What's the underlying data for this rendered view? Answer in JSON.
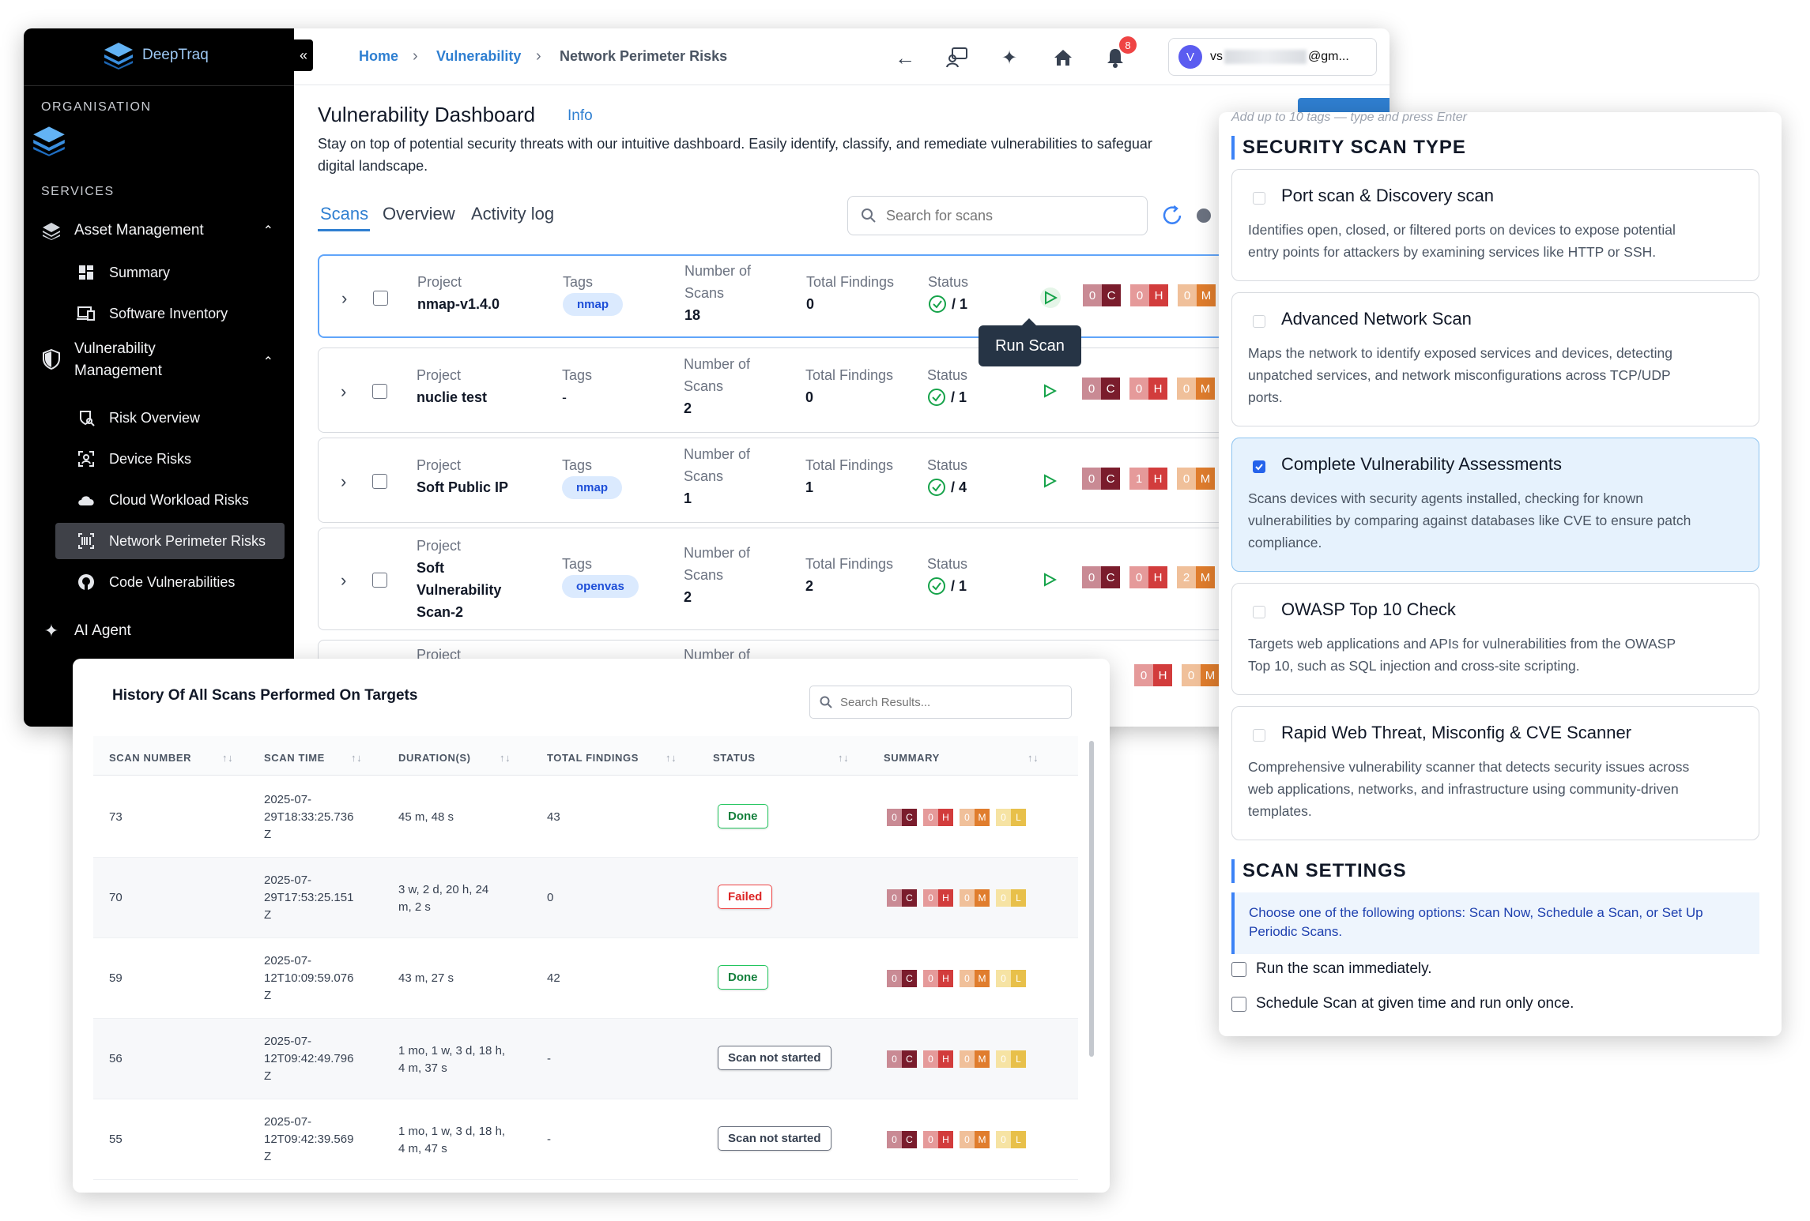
{
  "sidebar": {
    "brand": "DeepTraq",
    "org_heading": "ORGANISATION",
    "services_heading": "SERVICES",
    "asset_management": "Asset Management",
    "summary": "Summary",
    "software_inventory": "Software Inventory",
    "vulnerability_management_l1": "Vulnerability",
    "vulnerability_management_l2": "Management",
    "risk_overview": "Risk Overview",
    "device_risks": "Device Risks",
    "cloud_workload_risks": "Cloud Workload Risks",
    "network_perimeter_risks": "Network Perimeter Risks",
    "code_vulnerabilities": "Code Vulnerabilities",
    "ai_agent": "AI Agent",
    "collapse_glyph": "«"
  },
  "topbar": {
    "crumb_home": "Home",
    "crumb_vuln": "Vulnerability",
    "crumb_current": "Network Perimeter Risks",
    "notification_count": "8",
    "avatar_letter": "V",
    "user_prefix": "vs",
    "user_suffix": "@gm..."
  },
  "dashboard": {
    "title": "Vulnerability Dashboard",
    "info_link": "Info",
    "desc_l1": "Stay on top of potential security threats with our intuitive dashboard. Easily identify, classify, and remediate vulnerabilities to safeguar",
    "desc_l2": "digital landscape.",
    "tabs": {
      "scans": "Scans",
      "overview": "Overview",
      "activity": "Activity log"
    },
    "search_placeholder": "Search for scans",
    "tooltip": "Run Scan",
    "labels": {
      "project": "Project",
      "tags": "Tags",
      "scans_l1": "Number of",
      "scans_l2": "Scans",
      "findings": "Total Findings",
      "status": "Status"
    },
    "rows": [
      {
        "project": "nmap-v1.4.0",
        "tag": "nmap",
        "scans": "18",
        "findings": "0",
        "status": "/ 1",
        "c": "0",
        "h": "0",
        "m": "0"
      },
      {
        "project": "nuclie test",
        "tag": "-",
        "scans": "2",
        "findings": "0",
        "status": "/ 1",
        "c": "0",
        "h": "0",
        "m": "0"
      },
      {
        "project": "Soft Public IP",
        "tag": "nmap",
        "scans": "1",
        "findings": "1",
        "status": "/ 4",
        "c": "0",
        "h": "1",
        "m": "0"
      },
      {
        "project_l1": "Soft",
        "project_l2": "Vulnerability",
        "project_l3": "Scan-2",
        "tag": "openvas",
        "scans": "2",
        "findings": "2",
        "status": "/ 1",
        "c": "0",
        "h": "0",
        "m": "2"
      }
    ],
    "partial_row": {
      "project": "Project",
      "scans": "Number of",
      "h": "0",
      "m": "0"
    },
    "badge_letters": {
      "c": "C",
      "h": "H",
      "m": "M",
      "l": "L"
    }
  },
  "history": {
    "title": "History Of All Scans Performed On Targets",
    "search_placeholder": "Search Results...",
    "columns": {
      "scan_number": "SCAN NUMBER",
      "scan_time": "SCAN TIME",
      "duration": "DURATION(S)",
      "total_findings": "TOTAL FINDINGS",
      "status": "STATUS",
      "summary": "SUMMARY"
    },
    "sort_glyph": "↑↓",
    "rows": [
      {
        "num": "73",
        "t1": "2025-07-",
        "t2": "29T18:33:25.736",
        "t3": "Z",
        "d1": "45 m, 48 s",
        "d2": "",
        "findings": "43",
        "status": "Done"
      },
      {
        "num": "70",
        "t1": "2025-07-",
        "t2": "29T17:53:25.151",
        "t3": "Z",
        "d1": "3 w, 2 d, 20 h, 24",
        "d2": "m, 2 s",
        "findings": "0",
        "status": "Failed"
      },
      {
        "num": "59",
        "t1": "2025-07-",
        "t2": "12T10:09:59.076",
        "t3": "Z",
        "d1": "43 m, 27 s",
        "d2": "",
        "findings": "42",
        "status": "Done"
      },
      {
        "num": "56",
        "t1": "2025-07-",
        "t2": "12T09:42:49.796",
        "t3": "Z",
        "d1": "1 mo, 1 w, 3 d, 18 h,",
        "d2": "4 m, 37 s",
        "findings": "-",
        "status": "Scan not started"
      },
      {
        "num": "55",
        "t1": "2025-07-",
        "t2": "12T09:42:39.569",
        "t3": "Z",
        "d1": "1 mo, 1 w, 3 d, 18 h,",
        "d2": "4 m, 47 s",
        "findings": "-",
        "status": "Scan not started"
      }
    ],
    "summary_counts": {
      "c": "0",
      "h": "0",
      "m": "0",
      "l": "0"
    }
  },
  "scan_panel": {
    "tags_hint": "Add up to 10 tags — type and press Enter",
    "type_heading": "SECURITY SCAN TYPE",
    "options": [
      {
        "title": "Port scan & Discovery scan",
        "d1": "Identifies open, closed, or filtered ports on devices to expose potential",
        "d2": "entry points for attackers by examining services like HTTP or SSH.",
        "d3": ""
      },
      {
        "title": "Advanced Network Scan",
        "d1": "Maps the network to identify exposed services and devices, detecting",
        "d2": "unpatched services, and network misconfigurations across TCP/UDP",
        "d3": "ports."
      },
      {
        "title": "Complete Vulnerability Assessments",
        "d1": "Scans devices with security agents installed, checking for known",
        "d2": "vulnerabilities by comparing against databases like CVE to ensure patch",
        "d3": "compliance."
      },
      {
        "title": "OWASP Top 10 Check",
        "d1": "Targets web applications and APIs for vulnerabilities from the OWASP",
        "d2": "Top 10, such as SQL injection and cross-site scripting.",
        "d3": ""
      },
      {
        "title": "Rapid Web Threat, Misconfig & CVE Scanner",
        "d1": "Comprehensive vulnerability scanner that detects security issues across",
        "d2": "web applications, networks, and infrastructure using community-driven",
        "d3": "templates."
      }
    ],
    "settings_heading": "SCAN SETTINGS",
    "settings_info_l1": "Choose one of the following options: Scan Now, Schedule a Scan, or Set Up",
    "settings_info_l2": "Periodic Scans.",
    "run_now": "Run the scan immediately.",
    "schedule_once": "Schedule Scan at given time and run only once."
  },
  "colors": {
    "accent": "#2f7fd1",
    "critical_light": "#c98a94",
    "critical": "#7a1c2c",
    "high_light": "#e59a9a",
    "high": "#d23c3c",
    "medium_light": "#f0c09a",
    "medium": "#e07d2d",
    "low_light": "#f6e3a3",
    "low": "#e8c04a"
  }
}
